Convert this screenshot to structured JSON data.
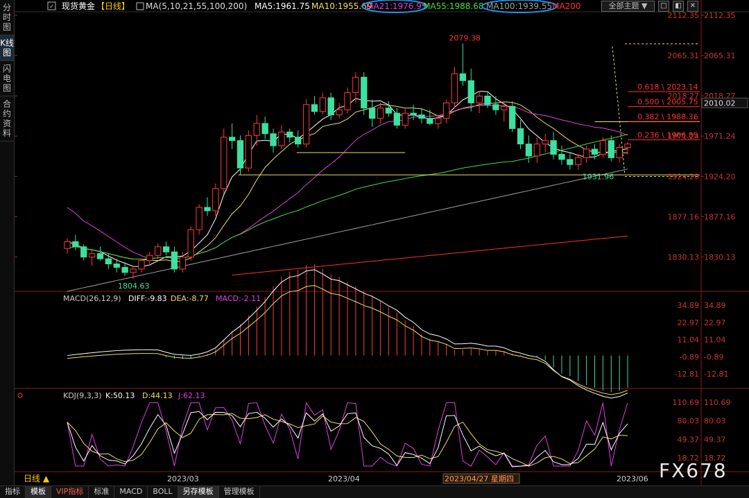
{
  "sidebar": {
    "tabs": [
      {
        "label": "分时图",
        "active": false
      },
      {
        "label": "K线图",
        "active": true
      },
      {
        "label": "闪电图",
        "active": false
      },
      {
        "label": "合约资料",
        "active": false
      }
    ]
  },
  "header": {
    "instrument": "现货黄金",
    "period": "【日线】",
    "ma_params": "MA(5,10,21,55,100,200)",
    "ma_values": [
      {
        "label": "MA5:1961.75",
        "color": "#ffffff"
      },
      {
        "label": "MA10:1955.69",
        "color": "#f0e060"
      },
      {
        "label": "MA21:1976.95",
        "color": "#e040e0",
        "circled": true
      },
      {
        "label": "MA55:1988.68",
        "color": "#40e040"
      },
      {
        "label": "MA100:1939.55",
        "color": "#a0a0a0",
        "circled": true
      },
      {
        "label": "MA200",
        "color": "#ff3030"
      }
    ],
    "scheme_button": "全部主题 ▼",
    "window_controls": [
      "□",
      "◧",
      "✕"
    ]
  },
  "price_axis": {
    "ticks": [
      "2112.35",
      "2065.31",
      "2018.27",
      "1971.24",
      "1924.20",
      "1877.16",
      "1830.13"
    ],
    "current_price": "2010.02"
  },
  "annotations": {
    "high": "2079.38",
    "low_left": "1804.63",
    "low_right": "1931.96"
  },
  "fibonacci": [
    "0.618 \\ 2023.14",
    "0.500 \\ 2005.75",
    "0.382 \\ 1988.36",
    "0.236 \\ 1966.85"
  ],
  "macd": {
    "title": "MACD(26,12,9)",
    "diff": "DIFF:-9.83",
    "dea": "DEA:-8.77",
    "macd": "MACD:-2.11",
    "ticks": [
      "34.89",
      "22.97",
      "11.04",
      "-0.89",
      "-12.81"
    ]
  },
  "kdj": {
    "title": "KDJ(9,3,3)",
    "k": "K:50.13",
    "d": "D:44.13",
    "j": "J:62.13",
    "ticks": [
      "110.69",
      "80.03",
      "49.37",
      "18.72"
    ]
  },
  "time_axis": {
    "period_button": "日线 ▲",
    "labels": [
      "2023/03",
      "2023/04",
      "2023/04/27 星期四",
      "2023/06"
    ]
  },
  "bottom_tabs": [
    {
      "label": "指标",
      "active": false
    },
    {
      "label": "模板",
      "active": true
    },
    {
      "label": "VIP指标",
      "active": false,
      "vip": true
    },
    {
      "label": "标准",
      "active": false
    },
    {
      "label": "MACD",
      "active": false
    },
    {
      "label": "BOLL",
      "active": false
    },
    {
      "label": "另存模板",
      "active": true
    },
    {
      "label": "管理模板",
      "active": false
    }
  ],
  "watermark": "FX678",
  "chart_data": {
    "type": "candlestick",
    "instrument": "现货黄金",
    "period": "日线",
    "ylim": [
      1790,
      2112.35
    ],
    "ohlc": [
      [
        1840,
        1852,
        1834,
        1848
      ],
      [
        1848,
        1856,
        1838,
        1842
      ],
      [
        1842,
        1845,
        1826,
        1830
      ],
      [
        1830,
        1838,
        1820,
        1834
      ],
      [
        1834,
        1842,
        1826,
        1828
      ],
      [
        1828,
        1834,
        1816,
        1822
      ],
      [
        1822,
        1828,
        1812,
        1818
      ],
      [
        1818,
        1824,
        1808,
        1812
      ],
      [
        1812,
        1820,
        1804.6,
        1816
      ],
      [
        1816,
        1828,
        1812,
        1826
      ],
      [
        1826,
        1836,
        1820,
        1832
      ],
      [
        1832,
        1846,
        1828,
        1842
      ],
      [
        1842,
        1848,
        1832,
        1836
      ],
      [
        1836,
        1842,
        1812,
        1816
      ],
      [
        1816,
        1836,
        1812,
        1830
      ],
      [
        1830,
        1866,
        1826,
        1862
      ],
      [
        1862,
        1892,
        1856,
        1888
      ],
      [
        1888,
        1900,
        1878,
        1884
      ],
      [
        1884,
        1916,
        1878,
        1910
      ],
      [
        1910,
        1980,
        1904,
        1970
      ],
      [
        1970,
        1986,
        1956,
        1966
      ],
      [
        1966,
        1972,
        1926,
        1934
      ],
      [
        1934,
        1978,
        1930,
        1972
      ],
      [
        1972,
        1996,
        1960,
        1986
      ],
      [
        1986,
        1994,
        1968,
        1974
      ],
      [
        1974,
        1980,
        1952,
        1960
      ],
      [
        1960,
        1984,
        1956,
        1976
      ],
      [
        1976,
        1980,
        1964,
        1970
      ],
      [
        1970,
        1978,
        1958,
        1962
      ],
      [
        1962,
        2014,
        1958,
        2008
      ],
      [
        2008,
        2018,
        1996,
        2000
      ],
      [
        2000,
        2022,
        1996,
        2016
      ],
      [
        2016,
        2022,
        1990,
        1996
      ],
      [
        1996,
        2010,
        1992,
        2002
      ],
      [
        2002,
        2028,
        1998,
        2022
      ],
      [
        2022,
        2046,
        2010,
        2040
      ],
      [
        2040,
        2046,
        1996,
        2004
      ],
      [
        2004,
        2014,
        1982,
        1992
      ],
      [
        1992,
        2010,
        1986,
        2004
      ],
      [
        2004,
        2012,
        1994,
        1998
      ],
      [
        1998,
        2004,
        1980,
        1984
      ],
      [
        1984,
        2004,
        1980,
        1998
      ],
      [
        1998,
        2008,
        1990,
        1996
      ],
      [
        1996,
        2004,
        1986,
        1992
      ],
      [
        1992,
        2002,
        1984,
        1986
      ],
      [
        1986,
        1996,
        1980,
        1992
      ],
      [
        1992,
        2014,
        1986,
        2010
      ],
      [
        2010,
        2052,
        2004,
        2044
      ],
      [
        2044,
        2079.38,
        2030,
        2036
      ],
      [
        2036,
        2050,
        2000,
        2010
      ],
      [
        2010,
        2024,
        1998,
        2018
      ],
      [
        2018,
        2022,
        2004,
        2008
      ],
      [
        2008,
        2018,
        1996,
        2002
      ],
      [
        2002,
        2012,
        1988,
        2006
      ],
      [
        2006,
        2012,
        1976,
        1980
      ],
      [
        1980,
        1990,
        1956,
        1962
      ],
      [
        1962,
        1972,
        1940,
        1948
      ],
      [
        1948,
        1970,
        1940,
        1962
      ],
      [
        1962,
        1974,
        1952,
        1966
      ],
      [
        1966,
        1976,
        1944,
        1950
      ],
      [
        1950,
        1960,
        1938,
        1944
      ],
      [
        1944,
        1952,
        1932,
        1938
      ],
      [
        1938,
        1950,
        1931.96,
        1946
      ],
      [
        1946,
        1960,
        1940,
        1956
      ],
      [
        1956,
        1962,
        1944,
        1950
      ],
      [
        1950,
        1970,
        1946,
        1966
      ],
      [
        1966,
        1972,
        1942,
        1946
      ],
      [
        1946,
        1962,
        1940,
        1958
      ],
      [
        1958,
        1964,
        1950,
        1962
      ]
    ]
  }
}
